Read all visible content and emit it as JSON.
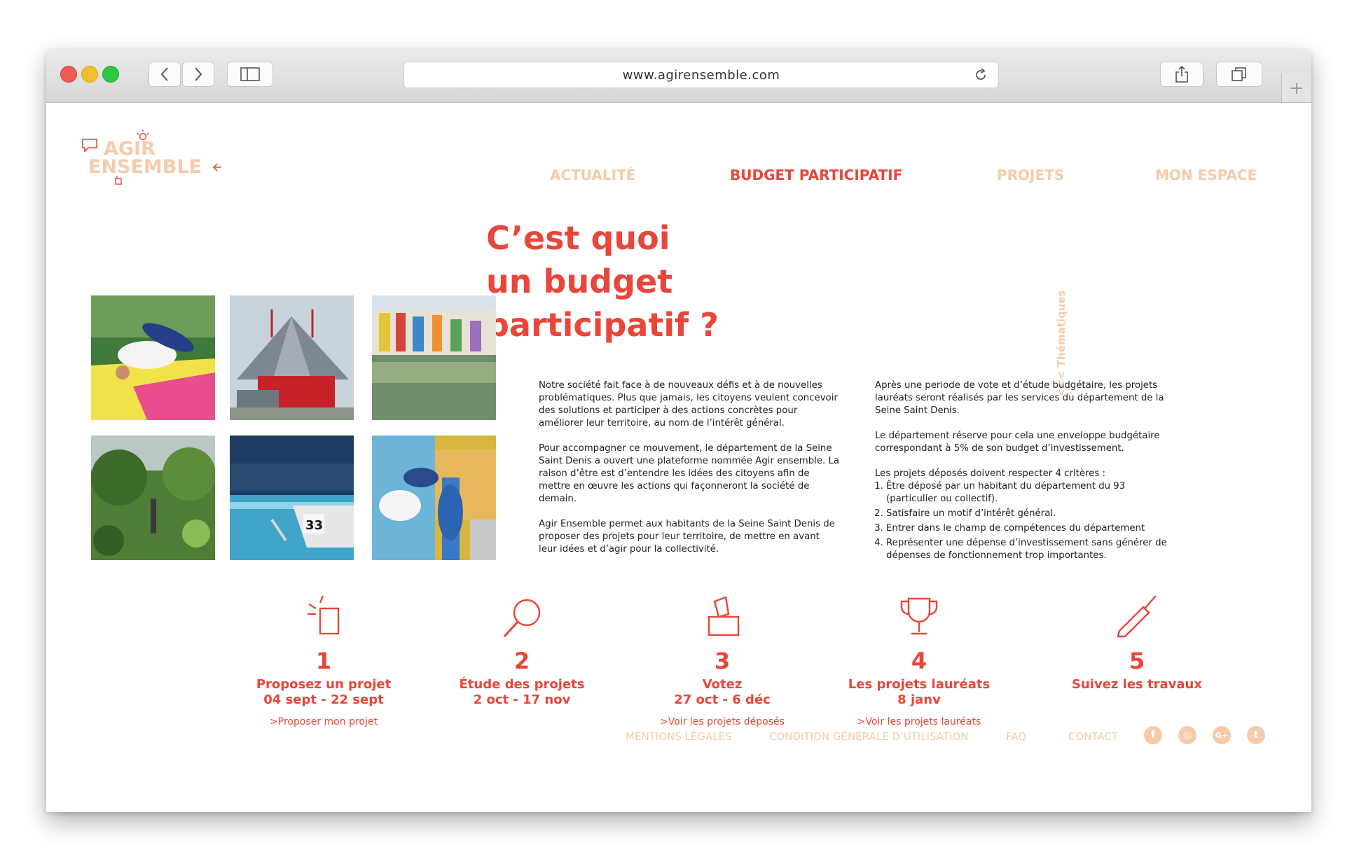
{
  "browser": {
    "url": "www.agirensemble.com"
  },
  "logo": {
    "line1": "AGIR",
    "line2": "ENSEMBLE"
  },
  "nav": [
    {
      "label": "ACTUALITÉ",
      "active": false
    },
    {
      "label": "BUDGET PARTICIPATIF",
      "active": true
    },
    {
      "label": "PROJETS",
      "active": false
    },
    {
      "label": "MON ESPACE",
      "active": false
    }
  ],
  "heading": {
    "line1": "C’est quoi",
    "line2": "un budget",
    "line3": "participatif ?"
  },
  "left_text": [
    "Notre société fait face à de nouveaux défis et à de nouvelles problématiques. Plus que jamais, les citoyens veulent concevoir des solutions et participer à des actions concrètes pour améliorer leur territoire, au nom de l’intérêt général.",
    "Pour accompagner ce mouvement, le département de la Seine Saint Denis a ouvert une plateforme nommée Agir ensemble. La raison d’être est d’entendre les idées des citoyens afin de mettre en œuvre les actions qui façonneront la société de demain.",
    "Agir Ensemble permet aux habitants de la Seine Saint Denis de proposer des projets pour leur territoire, de mettre en avant leur idées et d’agir pour la collectivité."
  ],
  "right_text": {
    "p1": "Après une periode de vote et d’étude budgétaire, les projets lauréats seront réalisés par les services du département de la Seine Saint Denis.",
    "p2": "Le département réserve pour cela une enveloppe budgétaire correspondant à 5% de son budget d’investissement.",
    "p3": "Les projets déposés doivent respecter 4 critères :",
    "criteria": [
      "Être déposé par un habitant du département du 93 (particulier ou collectif).",
      "Satisfaire un motif d’intérêt général.",
      "Entrer dans le champ de compétences du département",
      "Représenter une dépense d’investissement sans générer de dépenses de fonctionnement trop importantes."
    ]
  },
  "side_label": "<<< Thématiques",
  "steps": [
    {
      "icon": "idea-card-icon",
      "num": "1",
      "title": "Proposez un projet",
      "date": "04 sept - 22 sept",
      "link": ">Proposer mon projet"
    },
    {
      "icon": "magnifier-icon",
      "num": "2",
      "title": "Étude des projets",
      "date": "2 oct - 17 nov",
      "link": ""
    },
    {
      "icon": "ballot-box-icon",
      "num": "3",
      "title": "Votez",
      "date": "27 oct - 6 déc",
      "link": ">Voir les projets déposés"
    },
    {
      "icon": "trophy-icon",
      "num": "4",
      "title": "Les projets lauréats",
      "date": "8 janv",
      "link": ">Voir les projets lauréats"
    },
    {
      "icon": "tool-icon",
      "num": "5",
      "title": "Suivez les travaux",
      "date": "",
      "link": ""
    }
  ],
  "footer": {
    "links": [
      "MENTIONS LÉGALES",
      "CONDITION GÉNÉRALE D’UTILISATION",
      "FAQ",
      "CONTACT"
    ],
    "social": [
      {
        "icon": "facebook-icon",
        "glyph": "f"
      },
      {
        "icon": "instagram-icon",
        "glyph": "◎"
      },
      {
        "icon": "google-plus-icon",
        "glyph": "G+"
      },
      {
        "icon": "twitter-icon",
        "glyph": "t"
      }
    ]
  },
  "colors": {
    "accent": "#e8463a",
    "muted": "#f5cbaa"
  }
}
